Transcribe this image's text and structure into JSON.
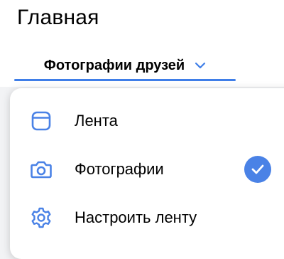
{
  "header": {
    "title": "Главная"
  },
  "feed_selector": {
    "label": "Фотографии друзей"
  },
  "menu": {
    "items": [
      {
        "label": "Лента",
        "icon": "feed-icon",
        "selected": false
      },
      {
        "label": "Фотографии",
        "icon": "camera-icon",
        "selected": true
      },
      {
        "label": "Настроить ленту",
        "icon": "gear-icon",
        "selected": false
      }
    ]
  },
  "colors": {
    "accent": "#3f7ee8",
    "icon": "#4a82e6"
  }
}
